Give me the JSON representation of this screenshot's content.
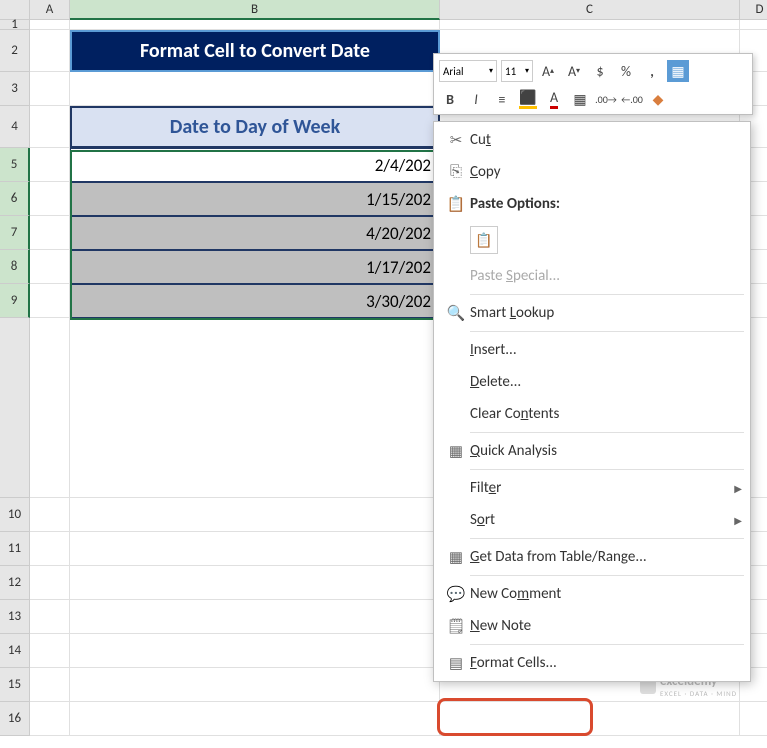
{
  "columns": {
    "a": "A",
    "b": "B",
    "c": "C",
    "d": "D"
  },
  "rows": [
    "1",
    "2",
    "3",
    "4",
    "5",
    "6",
    "7",
    "8",
    "9",
    "10",
    "11",
    "12",
    "13",
    "14",
    "15",
    "16"
  ],
  "title": "Format Cell to Convert Date",
  "header": "Date to Day of Week",
  "data_cells": [
    "2/4/202",
    "1/15/202",
    "4/20/202",
    "1/17/202",
    "3/30/202"
  ],
  "mini_toolbar": {
    "font": "Arial",
    "size": "11"
  },
  "menu": {
    "cut": "Cut",
    "copy": "Copy",
    "paste_options": "Paste Options:",
    "paste_special": "Paste Special...",
    "smart_lookup": "Smart Lookup",
    "insert": "Insert...",
    "delete": "Delete...",
    "clear_contents": "Clear Contents",
    "quick_analysis": "Quick Analysis",
    "filter": "Filter",
    "sort": "Sort",
    "get_data": "Get Data from Table/Range...",
    "new_comment": "New Comment",
    "new_note": "New Note",
    "format_cells": "Format Cells..."
  },
  "watermark": {
    "brand": "exceldemy",
    "tagline": "EXCEL · DATA · MIND"
  }
}
